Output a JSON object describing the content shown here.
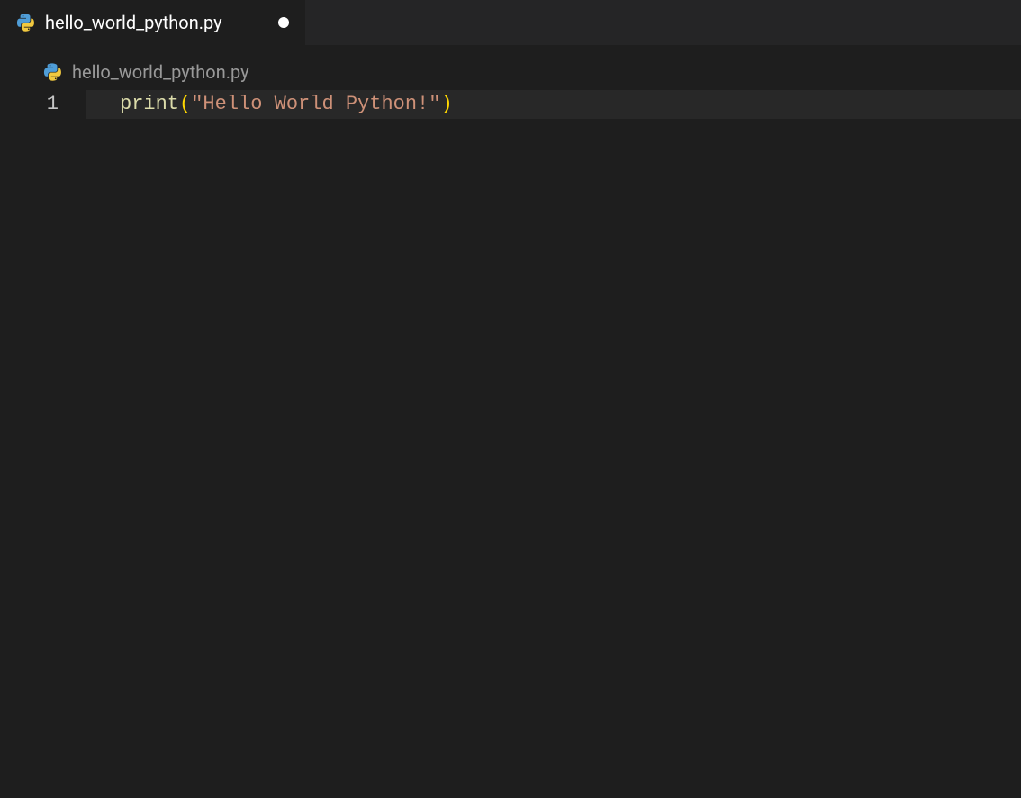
{
  "tab": {
    "filename": "hello_world_python.py",
    "icon": "python-file-icon",
    "dirty": true
  },
  "breadcrumb": {
    "filename": "hello_world_python.py",
    "icon": "python-file-icon"
  },
  "editor": {
    "lines": [
      {
        "number": "1",
        "tokens": {
          "func": "print",
          "open": "(",
          "string": "\"Hello World Python!\"",
          "close": ")"
        }
      }
    ]
  }
}
